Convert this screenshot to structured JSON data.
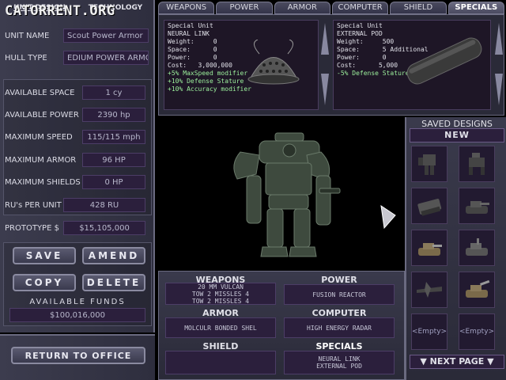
{
  "logo": "CATORRENT.ORG",
  "left_tabs": [
    {
      "label": "UNIT DESIGN",
      "active": true
    },
    {
      "label": "TECHNOLOGY",
      "active": false
    }
  ],
  "unit": {
    "name_label": "UNIT NAME",
    "name_value": "Scout Power Armor",
    "hull_label": "HULL TYPE",
    "hull_value": "EDIUM POWER ARMO"
  },
  "stats": [
    {
      "label": "AVAILABLE SPACE",
      "value": "1 cy"
    },
    {
      "label": "AVAILABLE POWER",
      "value": "2390 hp"
    },
    {
      "label": "MAXIMUM SPEED",
      "value": "115/115 mph"
    },
    {
      "label": "MAXIMUM ARMOR",
      "value": "96 HP"
    },
    {
      "label": "MAXIMUM SHIELDS",
      "value": "0 HP"
    },
    {
      "label": "RU's PER UNIT",
      "value": "428 RU"
    },
    {
      "label": "PROTOTYPE $",
      "value": "$15,105,000"
    }
  ],
  "buttons": {
    "save": "SAVE",
    "amend": "AMEND",
    "copy": "COPY",
    "delete": "DELETE",
    "return": "RETURN TO OFFICE"
  },
  "funds": {
    "label": "AVAILABLE FUNDS",
    "value": "$100,016,000"
  },
  "top_tabs": [
    {
      "label": "WEAPONS",
      "active": false
    },
    {
      "label": "POWER",
      "active": false
    },
    {
      "label": "ARMOR",
      "active": false
    },
    {
      "label": "COMPUTER",
      "active": false
    },
    {
      "label": "SHIELD",
      "active": false
    },
    {
      "label": "SPECIALS",
      "active": true
    }
  ],
  "components": [
    {
      "type": "Special Unit",
      "name": "NEURAL LINK",
      "weight": "Weight:     0",
      "space": "Space:      0",
      "power": "Power:      0",
      "cost": "Cost:   3,000,000",
      "mods": [
        "+5% MaxSpeed modifier",
        "+10% Defense Stature",
        "+10% Accuracy modifier"
      ]
    },
    {
      "type": "Special Unit",
      "name": "EXTERNAL POD",
      "weight": "Weight:     500",
      "space": "Space:      5 Additional",
      "power": "Power:      0",
      "cost": "Cost:      5,000",
      "mods": [
        "-5% Defense Stature"
      ]
    }
  ],
  "saved_designs": {
    "title": "SAVED DESIGNS",
    "new_label": "NEW",
    "empty_label": "<Empty>",
    "next_page": "NEXT PAGE"
  },
  "loadout": {
    "weapons_title": "WEAPONS",
    "weapons": [
      "20 MM VULCAN",
      "TOW 2 MISSLES 4",
      "TOW 2 MISSLES 4"
    ],
    "power_title": "POWER",
    "power": "FUSION REACTOR",
    "armor_title": "ARMOR",
    "armor": "MOLCULR BONDED SHEL",
    "computer_title": "COMPUTER",
    "computer": "HIGH ENERGY RADAR",
    "shield_title": "SHIELD",
    "shield": "",
    "specials_title": "SPECIALS",
    "specials": [
      "NEURAL LINK",
      "EXTERNAL POD"
    ]
  },
  "colors": {
    "field_bg": "#2b1f3c",
    "mod_text": "#9cf09c",
    "panel": "#3a3a4c"
  }
}
